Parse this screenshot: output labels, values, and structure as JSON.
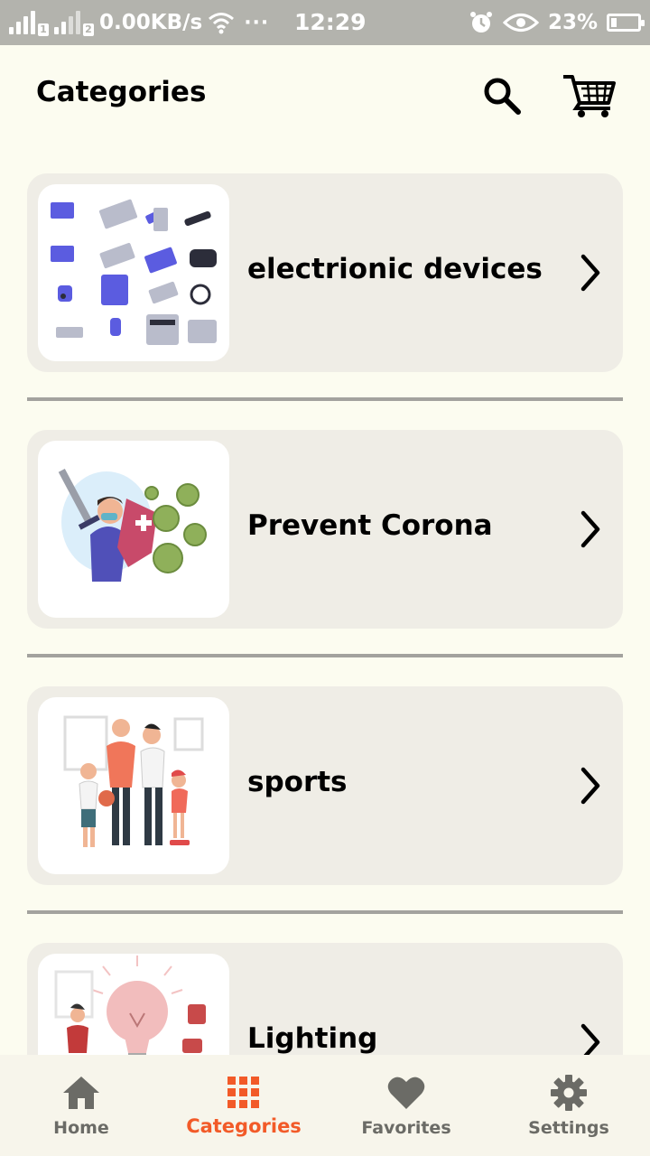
{
  "status_bar": {
    "sim1": "1",
    "sim2": "2",
    "speed": "0.00KB/s",
    "more": "···",
    "time": "12:29",
    "battery_percent": "23%",
    "battery_level": 0.23
  },
  "header": {
    "title": "Categories",
    "search_icon": "search-icon",
    "cart_icon": "cart-icon"
  },
  "categories": [
    {
      "label": "electrionic devices",
      "image": "electronic-devices-illustration"
    },
    {
      "label": "Prevent Corona",
      "image": "prevent-corona-illustration"
    },
    {
      "label": "sports",
      "image": "sports-family-illustration"
    },
    {
      "label": "Lighting",
      "image": "lighting-bulb-illustration"
    }
  ],
  "bottom_nav": {
    "active": "Categories",
    "items": [
      {
        "label": "Home",
        "icon": "home-icon"
      },
      {
        "label": "Categories",
        "icon": "grid-icon"
      },
      {
        "label": "Favorites",
        "icon": "heart-icon"
      },
      {
        "label": "Settings",
        "icon": "gear-icon"
      }
    ]
  },
  "colors": {
    "background": "#fcfcf0",
    "card": "#efede6",
    "accent": "#f25a28",
    "inactive": "#6b6b66",
    "status_bar": "#b3b3ad"
  }
}
